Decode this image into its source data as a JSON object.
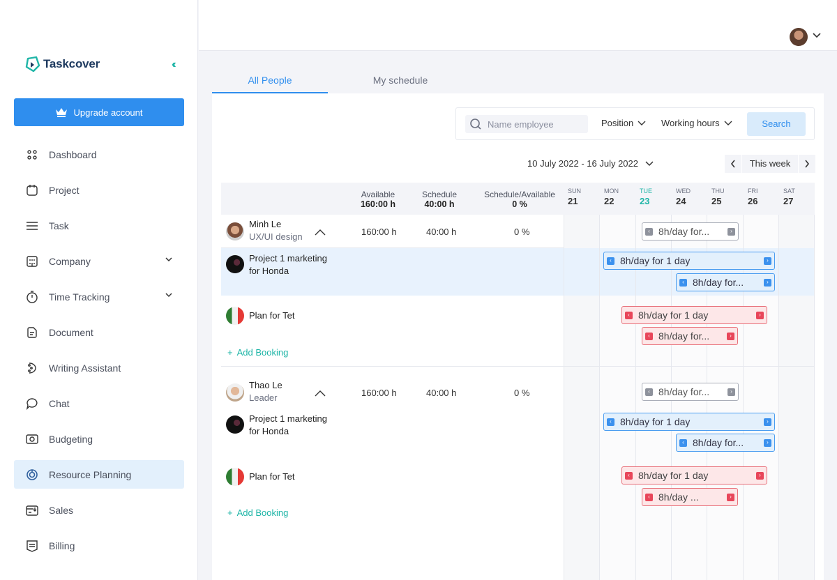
{
  "app": {
    "name": "Taskcover"
  },
  "sidebar": {
    "upgrade_label": "Upgrade account",
    "items": [
      {
        "label": "Dashboard"
      },
      {
        "label": "Project"
      },
      {
        "label": "Task"
      },
      {
        "label": "Company"
      },
      {
        "label": "Time Tracking"
      },
      {
        "label": "Document"
      },
      {
        "label": "Writing Assistant"
      },
      {
        "label": "Chat"
      },
      {
        "label": "Budgeting"
      },
      {
        "label": "Resource Planning"
      },
      {
        "label": "Sales"
      },
      {
        "label": "Billing"
      }
    ],
    "active_item": "Resource Planning"
  },
  "tabs": [
    {
      "label": "All People"
    },
    {
      "label": "My schedule"
    }
  ],
  "filters": {
    "search_placeholder": "Name employee",
    "position_label": "Position",
    "working_hours_label": "Working hours",
    "search_button": "Search"
  },
  "date_range": "10 July 2022 - 16 July 2022",
  "week_label": "This week",
  "columns": {
    "available": {
      "label": "Available",
      "value": "160:00 h"
    },
    "schedule": {
      "label": "Schedule",
      "value": "40:00 h"
    },
    "ratio": {
      "label": "Schedule/Available",
      "value": "0 %"
    }
  },
  "days": [
    {
      "name": "SUN",
      "num": "21"
    },
    {
      "name": "MON",
      "num": "22"
    },
    {
      "name": "TUE",
      "num": "23"
    },
    {
      "name": "WED",
      "num": "24"
    },
    {
      "name": "THU",
      "num": "25"
    },
    {
      "name": "FRI",
      "num": "26"
    },
    {
      "name": "SAT",
      "num": "27"
    }
  ],
  "today": "TUE",
  "people": [
    {
      "name": "Minh Le",
      "role": "UX/UI design",
      "available": "160:00 h",
      "schedule": "40:00 h",
      "ratio": "0 %",
      "summary_booking": "8h/day for...",
      "projects": [
        {
          "name_line1": "Project 1 marketing",
          "name_line2": "for Honda",
          "bookings": [
            "8h/day for 1 day",
            "8h/day for..."
          ]
        },
        {
          "name_line1": "Plan for Tet",
          "bookings": [
            "8h/day for 1 day",
            "8h/day for..."
          ]
        }
      ],
      "add_booking": "Add Booking"
    },
    {
      "name": "Thao Le",
      "role": "Leader",
      "available": "160:00 h",
      "schedule": "40:00 h",
      "ratio": "0 %",
      "summary_booking": "8h/day for...",
      "projects": [
        {
          "name_line1": "Project 1 marketing",
          "name_line2": "for Honda",
          "bookings": [
            "8h/day for 1 day",
            "8h/day for..."
          ]
        },
        {
          "name_line1": "Plan for Tet",
          "bookings": [
            "8h/day for 1 day",
            "8h/day ..."
          ]
        }
      ],
      "add_booking": "Add Booking"
    }
  ],
  "colors": {
    "primary": "#2f8eee",
    "accent": "#1fb5a7",
    "booking_gray": "#8e929c",
    "booking_blue": "#3b91ee",
    "booking_red": "#e8465a"
  }
}
